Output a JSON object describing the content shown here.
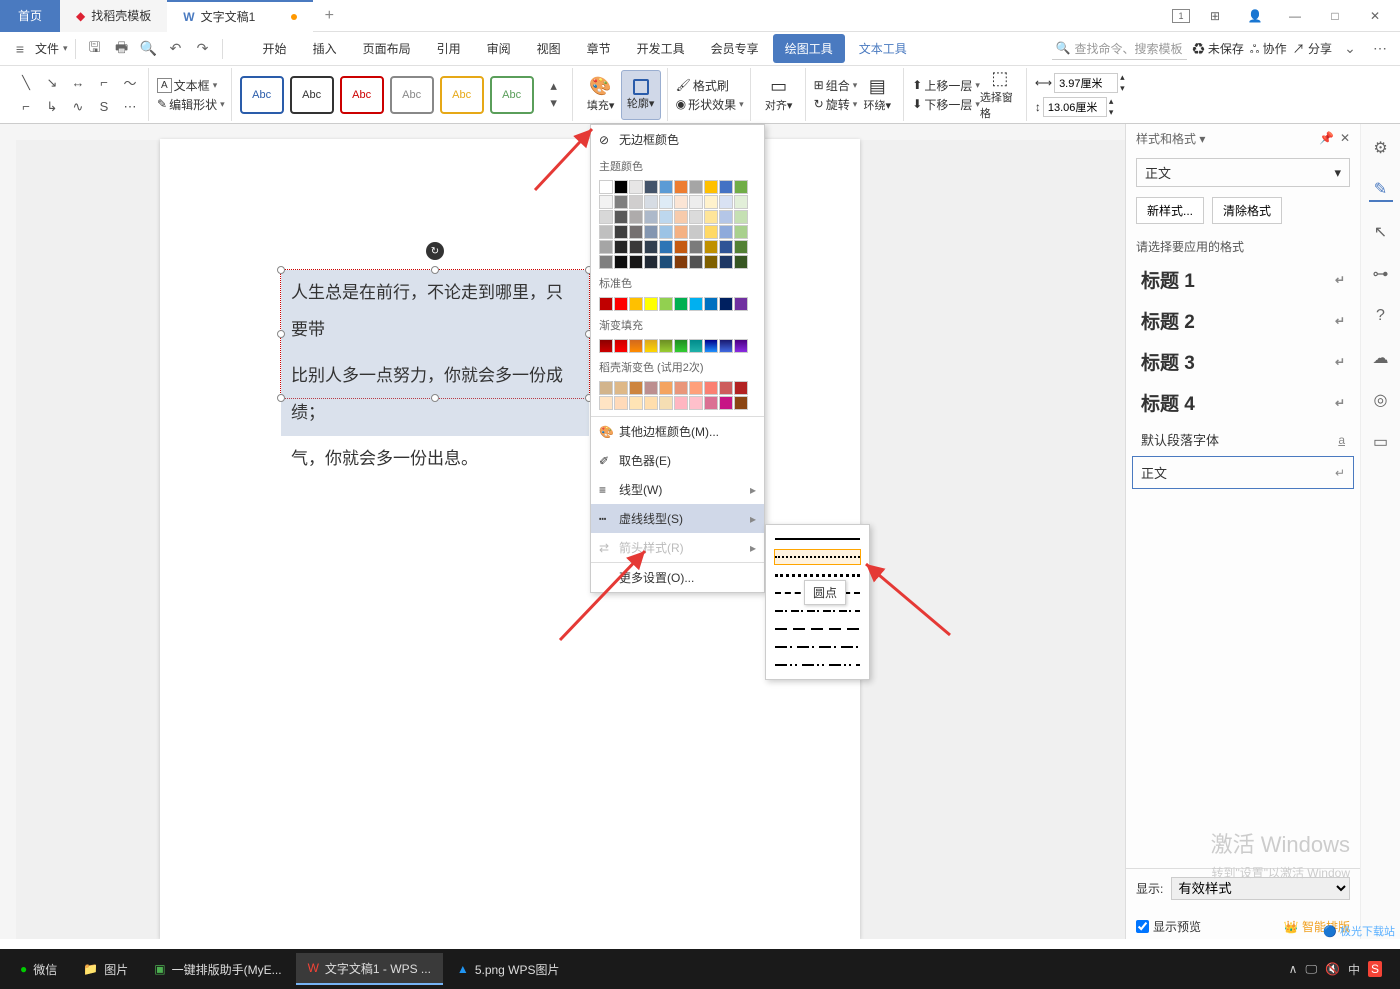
{
  "tabs": {
    "home": "首页",
    "template": "找稻壳模板",
    "doc": "文字文稿1"
  },
  "file_menu": "文件",
  "ribbon_tabs": [
    "开始",
    "插入",
    "页面布局",
    "引用",
    "审阅",
    "视图",
    "章节",
    "开发工具",
    "会员专享"
  ],
  "contextual_tab": "绘图工具",
  "text_tool_tab": "文本工具",
  "search_placeholder": "查找命令、搜索模板",
  "unsaved": "未保存",
  "collab": "协作",
  "share": "分享",
  "textbox_label": "文本框",
  "edit_shape": "编辑形状",
  "abc_label": "Abc",
  "fill": "填充",
  "outline": "轮廓",
  "format_painter": "格式刷",
  "shape_effect": "形状效果",
  "align": "对齐",
  "group": "组合",
  "rotate": "旋转",
  "wrap": "环绕",
  "up_layer": "上移一层",
  "down_layer": "下移一层",
  "sel_pane": "选择窗格",
  "height": "3.97厘米",
  "width": "13.06厘米",
  "outline_menu": {
    "none": "无边框颜色",
    "theme": "主题颜色",
    "std": "标准色",
    "gradient": "渐变填充",
    "template_grad": "稻壳渐变色 (试用2次)",
    "other": "其他边框颜色(M)...",
    "picker": "取色器(E)",
    "weight": "线型(W)",
    "dashes": "虚线线型(S)",
    "arrows": "箭头样式(R)",
    "more": "更多设置(O)..."
  },
  "dash_tooltip": "圆点",
  "textbox_lines": [
    "人生总是在前行，不论走到哪里，只要带",
    "比别人多一点努力，你就会多一份成绩；",
    "气，你就会多一份出息。"
  ],
  "panel": {
    "title": "样式和格式",
    "current": "正文",
    "new_btn": "新样式...",
    "clear_btn": "清除格式",
    "hint": "请选择要应用的格式",
    "styles": [
      "标题 1",
      "标题 2",
      "标题 3",
      "标题 4"
    ],
    "default_para": "默认段落字体",
    "body": "正文",
    "show_lbl": "显示:",
    "show_val": "有效样式",
    "preview": "显示预览",
    "smart": "智能排版"
  },
  "watermark": "激活 Windows",
  "watermark_sub": "转到\"设置\"以激活 Window",
  "taskbar": {
    "wechat": "微信",
    "pictures": "图片",
    "typeset": "一键排版助手(MyE...",
    "wps": "文字文稿1 - WPS ...",
    "png": "5.png  WPS图片"
  },
  "tray_lang": "中"
}
